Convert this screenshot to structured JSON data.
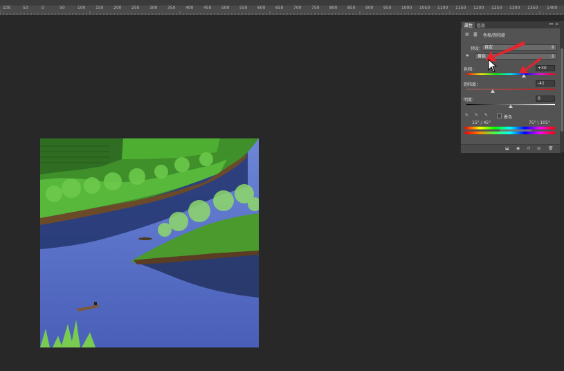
{
  "ruler": {
    "labels": [
      "100",
      "50",
      "0",
      "50",
      "100",
      "150",
      "200",
      "250",
      "300",
      "350",
      "400",
      "450",
      "500",
      "550",
      "600",
      "650",
      "700",
      "750",
      "800",
      "850",
      "900",
      "950",
      "1000",
      "1050",
      "1100",
      "1150",
      "1200",
      "1250",
      "1300",
      "1350",
      "1400"
    ]
  },
  "panel": {
    "tabs": [
      "属性",
      "信息"
    ],
    "menu_icon": "panel-menu-icon",
    "title": "色相/饱和度",
    "preset_label": "预设：",
    "preset_value": "自定",
    "channel_value": "黄色",
    "hue_label": "色相：",
    "hue_value": "+30",
    "saturation_label": "饱和度：",
    "saturation_value": "-41",
    "lightness_label": "明度：",
    "lightness_value": "0",
    "colorize_label": "着色",
    "range_left": "15° / 45°",
    "range_right": "75° \\ 105°",
    "slider_levels": {
      "hue": 0.65,
      "saturation": 0.3,
      "lightness": 0.5
    }
  },
  "colors": {
    "workspace": "#282828",
    "panel_bg": "#535353",
    "arrow_red": "#e8232b"
  }
}
